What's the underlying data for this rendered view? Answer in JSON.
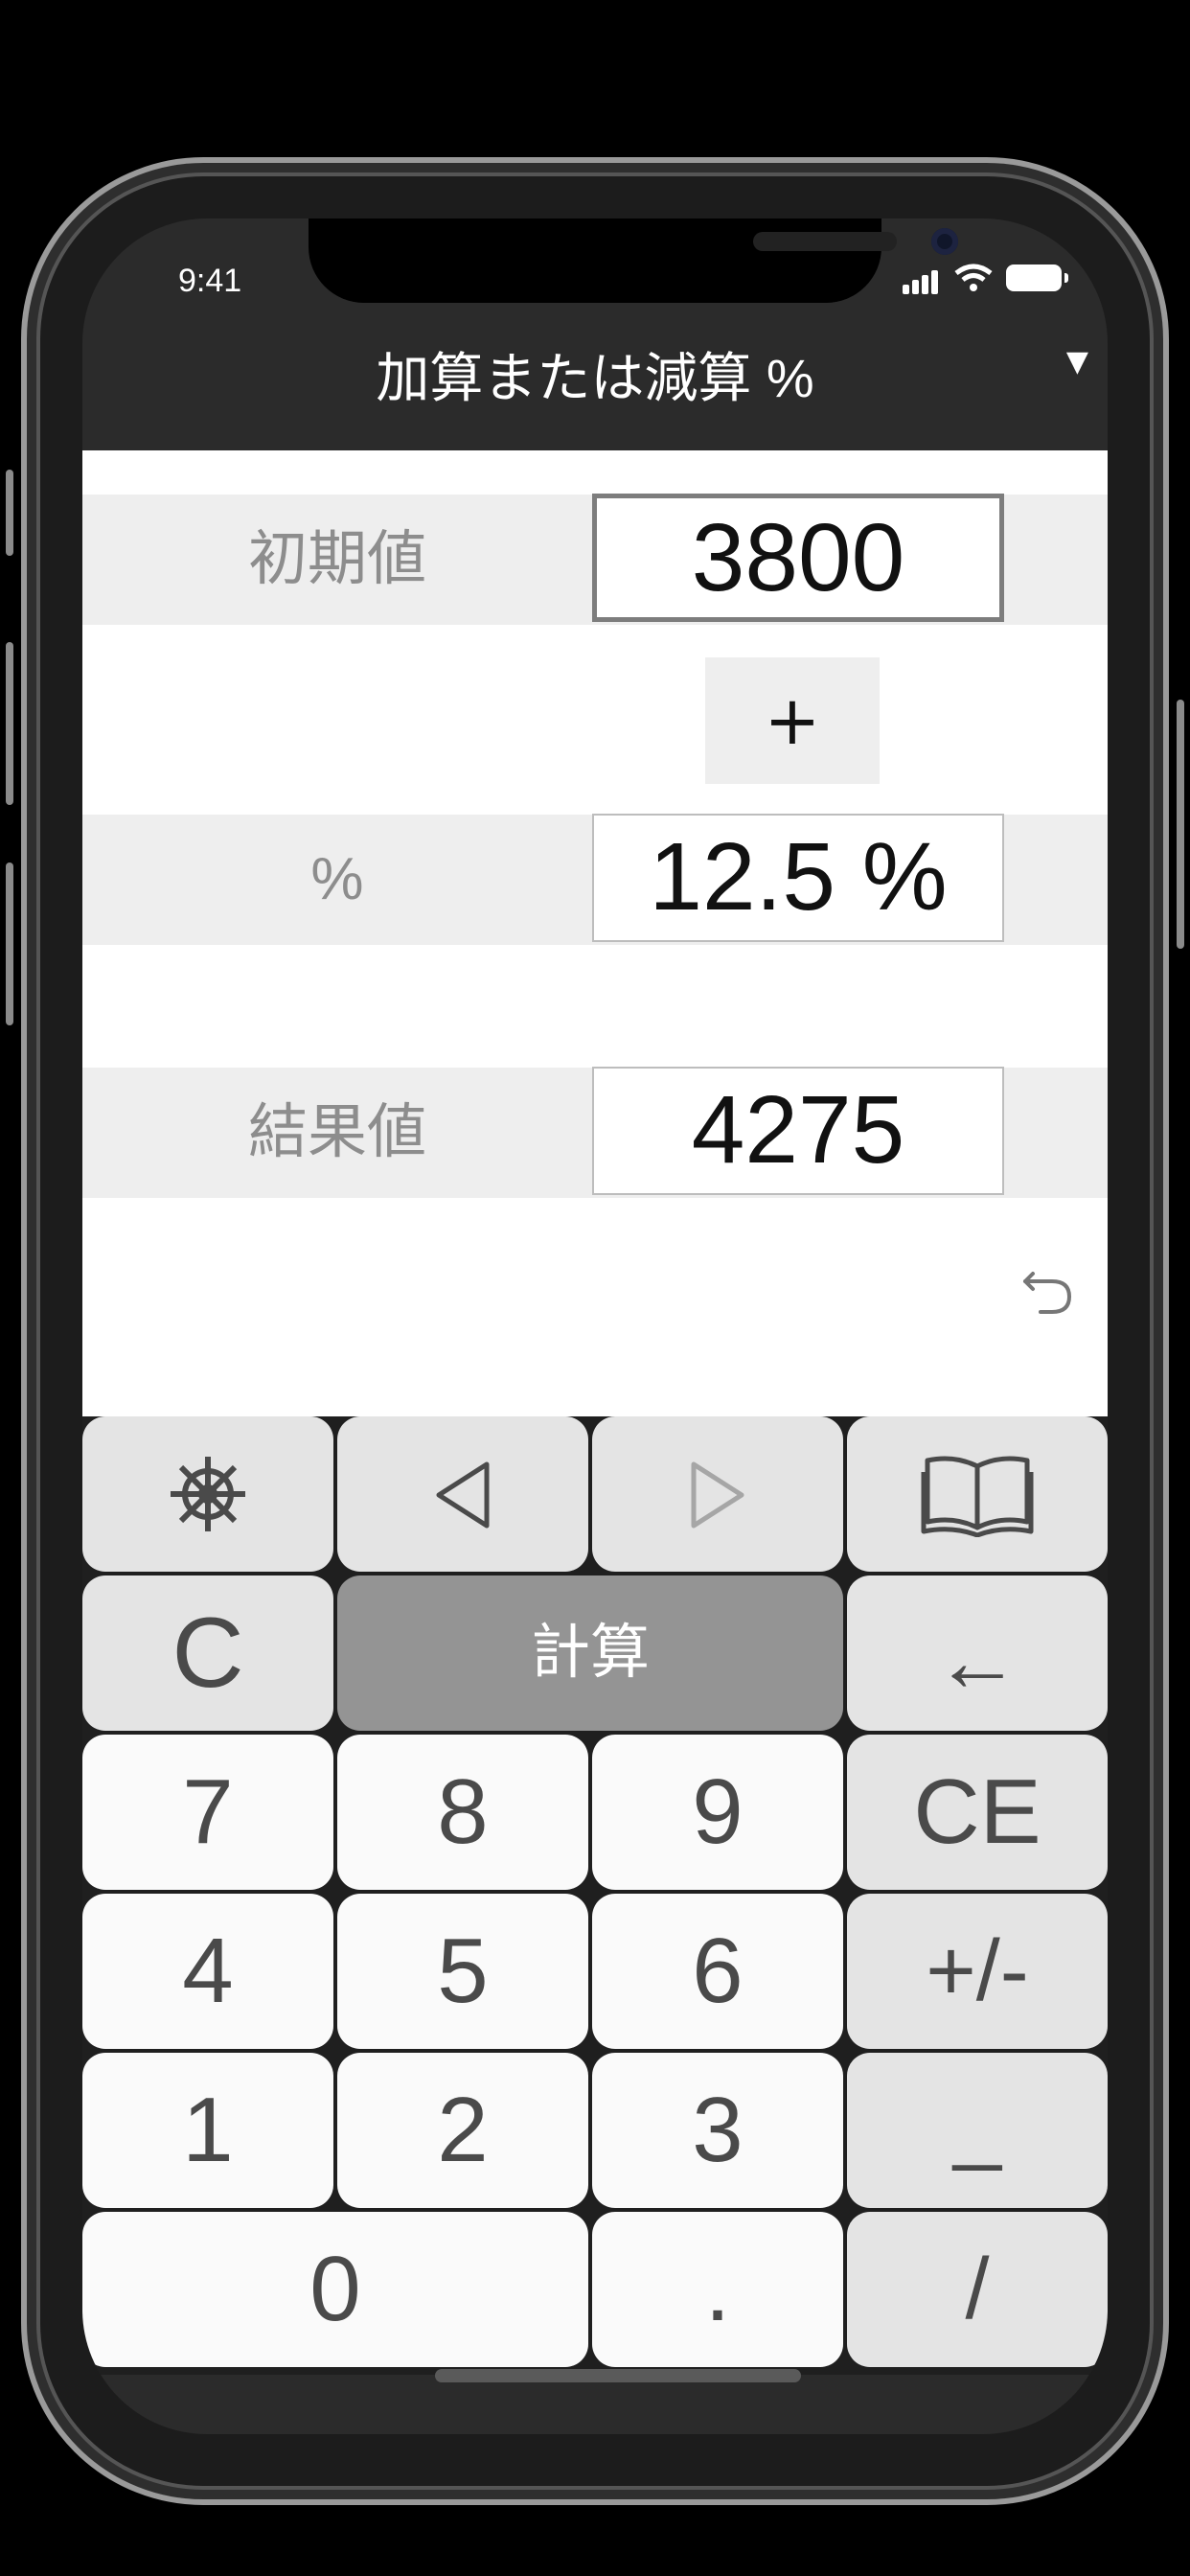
{
  "status_bar": {
    "time": "9:41"
  },
  "header": {
    "title": "加算または減算 %",
    "menu_icon": "triangle-down-icon"
  },
  "form": {
    "initial": {
      "label": "初期値",
      "value": "3800"
    },
    "operator": "+",
    "percent": {
      "label": "%",
      "value": "12.5 %"
    },
    "result": {
      "label": "結果値",
      "value": "4275"
    },
    "undo_icon": "undo-icon"
  },
  "keypad": {
    "row_tools": {
      "settings_icon": "ship-wheel-icon",
      "back_icon": "left-triangle-icon",
      "forward_icon": "right-triangle-icon",
      "book_icon": "open-book-icon"
    },
    "clear": "C",
    "calculate": "計算",
    "backspace": "←",
    "digits": {
      "d7": "7",
      "d8": "8",
      "d9": "9",
      "d4": "4",
      "d5": "5",
      "d6": "6",
      "d1": "1",
      "d2": "2",
      "d3": "3",
      "d0": "0"
    },
    "clear_entry": "CE",
    "plus_minus": "+/-",
    "underscore": "_",
    "decimal": ".",
    "slash": "/"
  },
  "colors": {
    "header_bg": "#2b2b2b",
    "row_bg": "#eeeeee",
    "calc_button": "#949494"
  }
}
